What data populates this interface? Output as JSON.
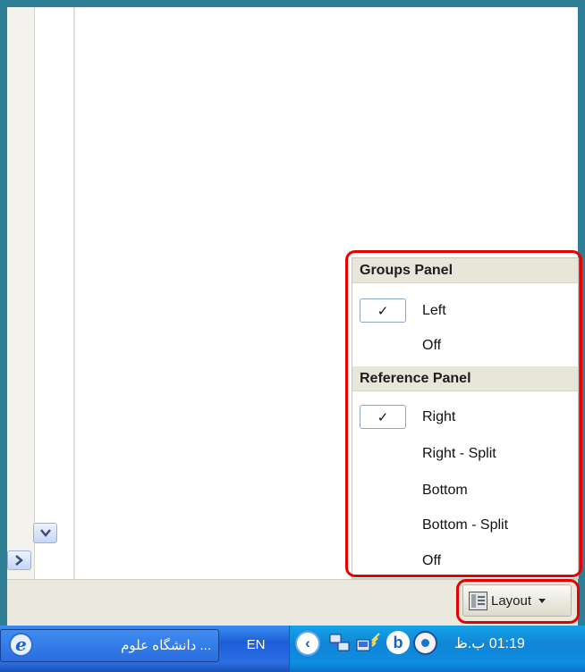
{
  "layout_menu": {
    "groups_header": "Groups Panel",
    "groups_items": [
      {
        "label": "Left",
        "checked": true
      },
      {
        "label": "Off",
        "checked": false
      }
    ],
    "reference_header": "Reference Panel",
    "reference_items": [
      {
        "label": "Right",
        "checked": true
      },
      {
        "label": "Right - Split",
        "checked": false
      },
      {
        "label": "Bottom",
        "checked": false
      },
      {
        "label": "Bottom - Split",
        "checked": false
      },
      {
        "label": "Off",
        "checked": false
      }
    ],
    "check_glyph": "✓"
  },
  "status_bar": {
    "layout_button_label": "Layout"
  },
  "taskbar": {
    "app_label": "... دانشگاه علوم",
    "language": "EN",
    "clock": "01:19 ب.ظ"
  },
  "colors": {
    "highlight_red": "#e60000",
    "frame_teal": "#2e7f95",
    "taskbar_blue": "#2b6ee4",
    "tray_blue": "#1185d6"
  },
  "icons": {
    "scroll_down": "chevron-down-icon",
    "scroll_right": "chevron-right-icon",
    "layout": "layout-panes-icon",
    "taskbar_app": "internet-explorer-icon",
    "tray_collapse": "chevron-left-icon",
    "tray": [
      "network-icon",
      "wireless-icon",
      "b-app-icon",
      "eye-app-icon"
    ]
  }
}
